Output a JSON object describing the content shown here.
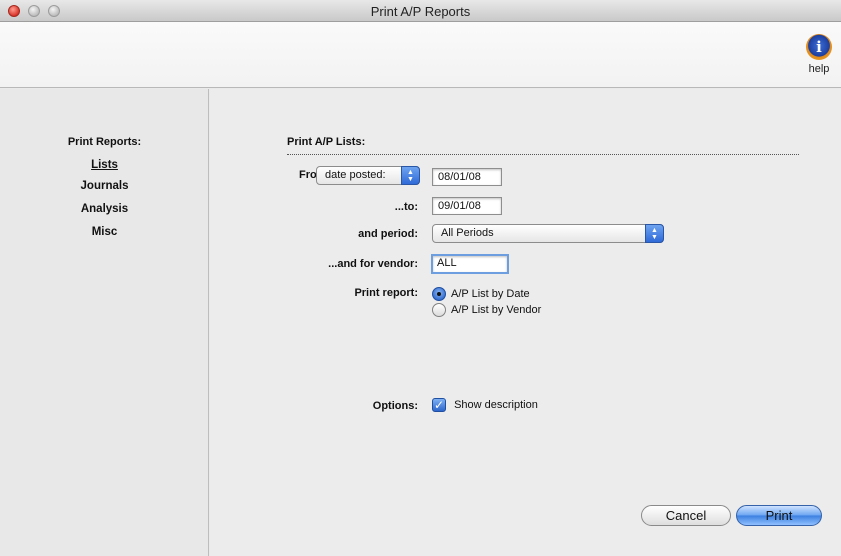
{
  "window": {
    "title": "Print A/P Reports"
  },
  "toolbar": {
    "help_label": "help",
    "help_icon": "info-icon"
  },
  "sidebar": {
    "title": "Print Reports:",
    "items": [
      {
        "label": "Lists",
        "active": true
      },
      {
        "label": "Journals",
        "active": false
      },
      {
        "label": "Analysis",
        "active": false
      },
      {
        "label": "Misc",
        "active": false
      }
    ]
  },
  "main": {
    "section_title": "Print A/P Lists:",
    "from_label": "From",
    "from_type": "date posted:",
    "from_date": "08/01/08",
    "to_label": "...to:",
    "to_date": "09/01/08",
    "period_label": "and period:",
    "period_value": "All Periods",
    "vendor_label": "...and for vendor:",
    "vendor_value": "ALL",
    "print_report_label": "Print report:",
    "report_options": [
      {
        "label": "A/P List by Date",
        "selected": true
      },
      {
        "label": "A/P List by Vendor",
        "selected": false
      }
    ],
    "options_label": "Options:",
    "show_description_label": "Show description",
    "show_description_checked": true
  },
  "buttons": {
    "cancel": "Cancel",
    "print": "Print"
  }
}
